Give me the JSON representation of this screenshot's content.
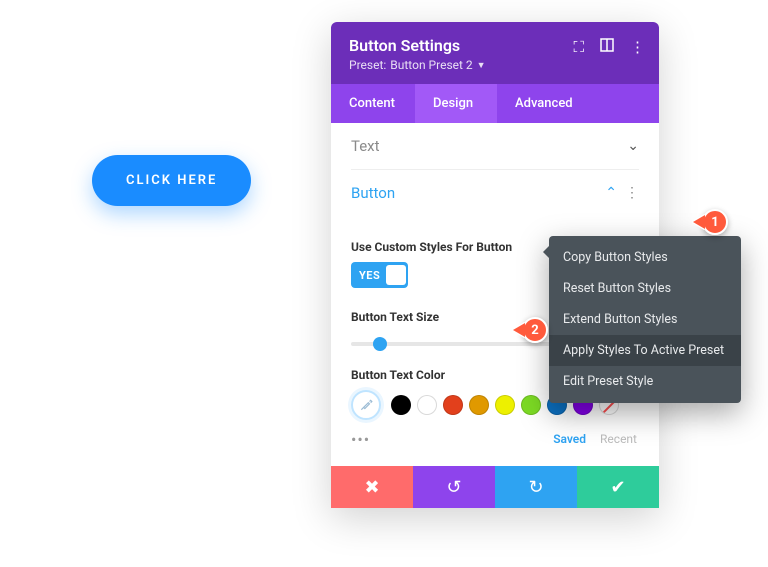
{
  "canvas": {
    "button_label": "CLICK HERE"
  },
  "panel": {
    "title": "Button Settings",
    "preset_prefix": "Preset:",
    "preset_name": "Button Preset 2",
    "tabs": {
      "content": "Content",
      "design": "Design",
      "advanced": "Advanced"
    },
    "sections": {
      "text": {
        "label": "Text"
      },
      "button": {
        "label": "Button",
        "fields": {
          "use_custom_label": "Use Custom Styles For Button",
          "toggle_value": "YES",
          "text_size_label": "Button Text Size",
          "text_color_label": "Button Text Color"
        },
        "palette_tabs": {
          "saved": "Saved",
          "recent": "Recent"
        },
        "colors": [
          "#000000",
          "#ffffff",
          "#e2401c",
          "#e09900",
          "#edf000",
          "#7cda24",
          "#0c71c3",
          "#8300e9"
        ],
        "more_dots": "•••"
      }
    }
  },
  "context_menu": {
    "items": [
      "Copy Button Styles",
      "Reset Button Styles",
      "Extend Button Styles",
      "Apply Styles To Active Preset",
      "Edit Preset Style"
    ],
    "active_index": 3
  },
  "callouts": {
    "one": "1",
    "two": "2"
  }
}
